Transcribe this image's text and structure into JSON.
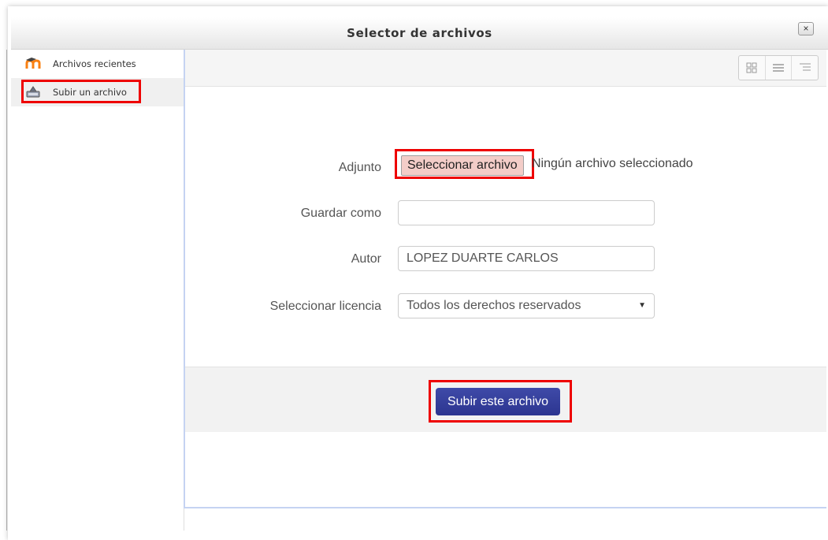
{
  "dialog": {
    "title": "Selector de archivos",
    "close_symbol": "×"
  },
  "sidebar": {
    "items": [
      {
        "label": "Archivos recientes",
        "icon": "moodle-logo-icon"
      },
      {
        "label": "Subir un archivo",
        "icon": "upload-icon",
        "active": true
      }
    ]
  },
  "toolbar": {
    "view_buttons": [
      "grid-view-icon",
      "list-view-icon",
      "tree-view-icon"
    ]
  },
  "form": {
    "attachment_label": "Adjunto",
    "file_button": "Seleccionar archivo",
    "no_file_text": "Ningún archivo seleccionado",
    "save_as_label": "Guardar como",
    "save_as_value": "",
    "author_label": "Autor",
    "author_value": "LOPEZ DUARTE CARLOS",
    "license_label": "Seleccionar licencia",
    "license_value": "Todos los derechos reservados"
  },
  "footer": {
    "submit_label": "Subir este archivo"
  },
  "colors": {
    "highlight": "#e00000",
    "submit_bg": "#333c9c",
    "file_btn_bg": "#f3cdc8",
    "panel_border": "#c5d3f2"
  }
}
